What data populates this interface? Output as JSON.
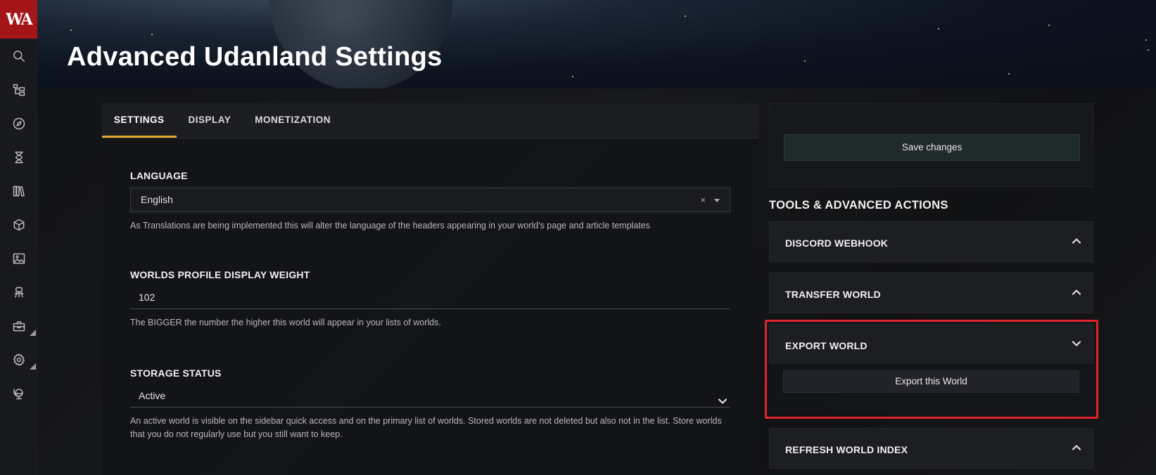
{
  "sidebar": {
    "logo_text": "WA",
    "icons": [
      "search-icon",
      "tree-structure-icon",
      "compass-icon",
      "hourglass-icon",
      "books-icon",
      "cube-icon",
      "image-icon",
      "robot-icon",
      "toolbox-icon",
      "gear-icon",
      "globe-icon"
    ]
  },
  "header": {
    "title": "Advanced Udanland Settings"
  },
  "tabs": [
    {
      "label": "SETTINGS",
      "active": true
    },
    {
      "label": "DISPLAY",
      "active": false
    },
    {
      "label": "MONETIZATION",
      "active": false
    }
  ],
  "settings": {
    "language": {
      "label": "LANGUAGE",
      "value": "English",
      "clear": "×",
      "help": "As Translations are being implemented this will alter the language of the headers appearing in your world's page and article templates"
    },
    "display_weight": {
      "label": "WORLDS PROFILE DISPLAY WEIGHT",
      "value": "102",
      "help": "The BIGGER the number the higher this world will appear in your lists of worlds."
    },
    "storage_status": {
      "label": "STORAGE STATUS",
      "value": "Active",
      "help": "An active world is visible on the sidebar quick access and on the primary list of worlds. Stored worlds are not deleted but also not in the list. Store worlds that you do not regularly use but you still want to keep."
    }
  },
  "right": {
    "save_label": "Save changes",
    "tools_title": "TOOLS & ADVANCED ACTIONS",
    "accordions": [
      {
        "label": "DISCORD WEBHOOK",
        "expanded": false
      },
      {
        "label": "TRANSFER WORLD",
        "expanded": false
      },
      {
        "label": "EXPORT WORLD",
        "expanded": true
      },
      {
        "label": "REFRESH WORLD INDEX",
        "expanded": false
      }
    ],
    "export_button": "Export this World"
  },
  "colors": {
    "accent_tab": "#e2a52e",
    "logo_bg": "#a31519",
    "highlight": "#e0242b"
  }
}
